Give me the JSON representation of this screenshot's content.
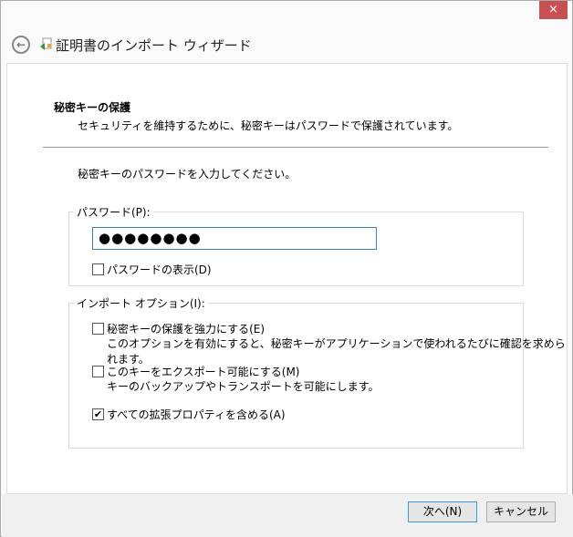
{
  "window": {
    "title": "証明書のインポート ウィザード",
    "close_label": "×"
  },
  "page": {
    "heading": "秘密キーの保護",
    "subheading": "セキュリティを維持するために、秘密キーはパスワードで保護されています。",
    "prompt": "秘密キーのパスワードを入力してください。"
  },
  "password_group": {
    "legend": "パスワード(P):",
    "value": "●●●●●●●●",
    "show_password": {
      "label": "パスワードの表示(D)",
      "checked": false
    }
  },
  "options_group": {
    "legend": "インポート オプション(I):",
    "options": [
      {
        "label": "秘密キーの保護を強力にする(E)",
        "description": "このオプションを有効にすると、秘密キーがアプリケーションで使われるたびに確認を求められます。",
        "checked": false
      },
      {
        "label": "このキーをエクスポート可能にする(M)",
        "description": "キーのバックアップやトランスポートを可能にします。",
        "checked": false
      },
      {
        "label": "すべての拡張プロパティを含める(A)",
        "checked": true,
        "mark": "✔"
      }
    ]
  },
  "footer": {
    "next_label": "次へ(N)",
    "cancel_label": "キャンセル"
  },
  "colors": {
    "close": "#c75050",
    "focus": "#3c7fb1"
  }
}
